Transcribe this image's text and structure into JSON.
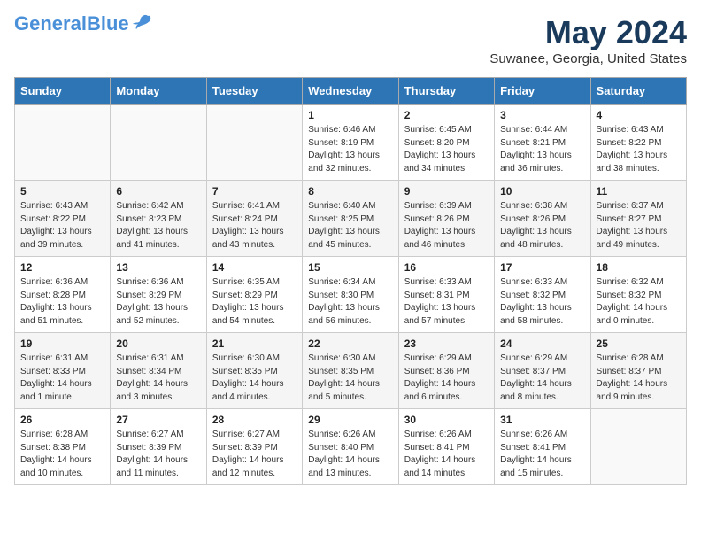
{
  "header": {
    "logo_general": "General",
    "logo_blue": "Blue",
    "main_title": "May 2024",
    "subtitle": "Suwanee, Georgia, United States"
  },
  "days_of_week": [
    "Sunday",
    "Monday",
    "Tuesday",
    "Wednesday",
    "Thursday",
    "Friday",
    "Saturday"
  ],
  "weeks": [
    [
      {
        "day": "",
        "info": ""
      },
      {
        "day": "",
        "info": ""
      },
      {
        "day": "",
        "info": ""
      },
      {
        "day": "1",
        "info": "Sunrise: 6:46 AM\nSunset: 8:19 PM\nDaylight: 13 hours\nand 32 minutes."
      },
      {
        "day": "2",
        "info": "Sunrise: 6:45 AM\nSunset: 8:20 PM\nDaylight: 13 hours\nand 34 minutes."
      },
      {
        "day": "3",
        "info": "Sunrise: 6:44 AM\nSunset: 8:21 PM\nDaylight: 13 hours\nand 36 minutes."
      },
      {
        "day": "4",
        "info": "Sunrise: 6:43 AM\nSunset: 8:22 PM\nDaylight: 13 hours\nand 38 minutes."
      }
    ],
    [
      {
        "day": "5",
        "info": "Sunrise: 6:43 AM\nSunset: 8:22 PM\nDaylight: 13 hours\nand 39 minutes."
      },
      {
        "day": "6",
        "info": "Sunrise: 6:42 AM\nSunset: 8:23 PM\nDaylight: 13 hours\nand 41 minutes."
      },
      {
        "day": "7",
        "info": "Sunrise: 6:41 AM\nSunset: 8:24 PM\nDaylight: 13 hours\nand 43 minutes."
      },
      {
        "day": "8",
        "info": "Sunrise: 6:40 AM\nSunset: 8:25 PM\nDaylight: 13 hours\nand 45 minutes."
      },
      {
        "day": "9",
        "info": "Sunrise: 6:39 AM\nSunset: 8:26 PM\nDaylight: 13 hours\nand 46 minutes."
      },
      {
        "day": "10",
        "info": "Sunrise: 6:38 AM\nSunset: 8:26 PM\nDaylight: 13 hours\nand 48 minutes."
      },
      {
        "day": "11",
        "info": "Sunrise: 6:37 AM\nSunset: 8:27 PM\nDaylight: 13 hours\nand 49 minutes."
      }
    ],
    [
      {
        "day": "12",
        "info": "Sunrise: 6:36 AM\nSunset: 8:28 PM\nDaylight: 13 hours\nand 51 minutes."
      },
      {
        "day": "13",
        "info": "Sunrise: 6:36 AM\nSunset: 8:29 PM\nDaylight: 13 hours\nand 52 minutes."
      },
      {
        "day": "14",
        "info": "Sunrise: 6:35 AM\nSunset: 8:29 PM\nDaylight: 13 hours\nand 54 minutes."
      },
      {
        "day": "15",
        "info": "Sunrise: 6:34 AM\nSunset: 8:30 PM\nDaylight: 13 hours\nand 56 minutes."
      },
      {
        "day": "16",
        "info": "Sunrise: 6:33 AM\nSunset: 8:31 PM\nDaylight: 13 hours\nand 57 minutes."
      },
      {
        "day": "17",
        "info": "Sunrise: 6:33 AM\nSunset: 8:32 PM\nDaylight: 13 hours\nand 58 minutes."
      },
      {
        "day": "18",
        "info": "Sunrise: 6:32 AM\nSunset: 8:32 PM\nDaylight: 14 hours\nand 0 minutes."
      }
    ],
    [
      {
        "day": "19",
        "info": "Sunrise: 6:31 AM\nSunset: 8:33 PM\nDaylight: 14 hours\nand 1 minute."
      },
      {
        "day": "20",
        "info": "Sunrise: 6:31 AM\nSunset: 8:34 PM\nDaylight: 14 hours\nand 3 minutes."
      },
      {
        "day": "21",
        "info": "Sunrise: 6:30 AM\nSunset: 8:35 PM\nDaylight: 14 hours\nand 4 minutes."
      },
      {
        "day": "22",
        "info": "Sunrise: 6:30 AM\nSunset: 8:35 PM\nDaylight: 14 hours\nand 5 minutes."
      },
      {
        "day": "23",
        "info": "Sunrise: 6:29 AM\nSunset: 8:36 PM\nDaylight: 14 hours\nand 6 minutes."
      },
      {
        "day": "24",
        "info": "Sunrise: 6:29 AM\nSunset: 8:37 PM\nDaylight: 14 hours\nand 8 minutes."
      },
      {
        "day": "25",
        "info": "Sunrise: 6:28 AM\nSunset: 8:37 PM\nDaylight: 14 hours\nand 9 minutes."
      }
    ],
    [
      {
        "day": "26",
        "info": "Sunrise: 6:28 AM\nSunset: 8:38 PM\nDaylight: 14 hours\nand 10 minutes."
      },
      {
        "day": "27",
        "info": "Sunrise: 6:27 AM\nSunset: 8:39 PM\nDaylight: 14 hours\nand 11 minutes."
      },
      {
        "day": "28",
        "info": "Sunrise: 6:27 AM\nSunset: 8:39 PM\nDaylight: 14 hours\nand 12 minutes."
      },
      {
        "day": "29",
        "info": "Sunrise: 6:26 AM\nSunset: 8:40 PM\nDaylight: 14 hours\nand 13 minutes."
      },
      {
        "day": "30",
        "info": "Sunrise: 6:26 AM\nSunset: 8:41 PM\nDaylight: 14 hours\nand 14 minutes."
      },
      {
        "day": "31",
        "info": "Sunrise: 6:26 AM\nSunset: 8:41 PM\nDaylight: 14 hours\nand 15 minutes."
      },
      {
        "day": "",
        "info": ""
      }
    ]
  ]
}
